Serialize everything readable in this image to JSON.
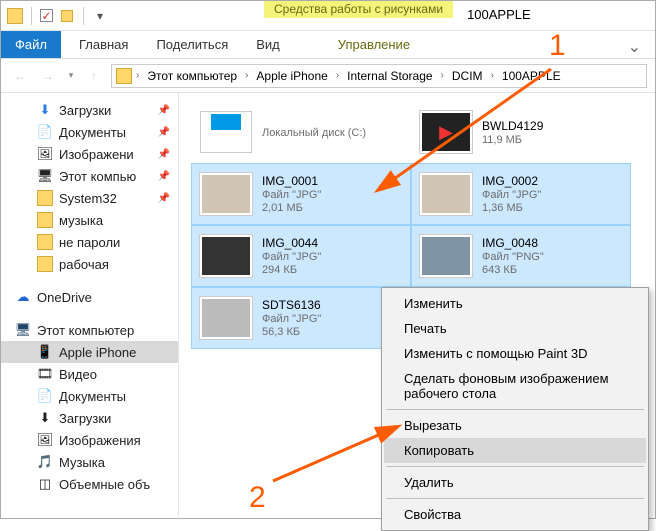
{
  "window": {
    "title": "100APPLE",
    "ctx_tab_header": "Средства работы с рисунками"
  },
  "ribbon": {
    "file": "Файл",
    "tabs": [
      "Главная",
      "Поделиться",
      "Вид"
    ],
    "ctx_tab": "Управление"
  },
  "breadcrumbs": [
    "Этот компьютер",
    "Apple iPhone",
    "Internal Storage",
    "DCIM",
    "100APPLE"
  ],
  "sidebar": {
    "quick": [
      {
        "label": "Загрузки",
        "icon": "download",
        "pinned": true
      },
      {
        "label": "Документы",
        "icon": "doc",
        "pinned": true
      },
      {
        "label": "Изображени",
        "icon": "picture",
        "pinned": true
      },
      {
        "label": "Этот компью",
        "icon": "pc",
        "pinned": true
      },
      {
        "label": "System32",
        "icon": "folder",
        "pinned": true
      },
      {
        "label": "музыка",
        "icon": "folder",
        "pinned": false
      },
      {
        "label": "не пароли",
        "icon": "folder",
        "pinned": false
      },
      {
        "label": "рабочая",
        "icon": "folder",
        "pinned": false
      }
    ],
    "onedrive": "OneDrive",
    "thispc_label": "Этот компьютер",
    "thispc": [
      {
        "label": "Apple iPhone",
        "icon": "phone",
        "selected": true
      },
      {
        "label": "Видео",
        "icon": "video"
      },
      {
        "label": "Документы",
        "icon": "doc"
      },
      {
        "label": "Загрузки",
        "icon": "download"
      },
      {
        "label": "Изображения",
        "icon": "picture"
      },
      {
        "label": "Музыка",
        "icon": "music"
      },
      {
        "label": "Объемные объ",
        "icon": "cube"
      }
    ]
  },
  "files": [
    {
      "name": "",
      "type": "Локальный диск (C:)",
      "size": "",
      "thumb": "drive",
      "selected": false
    },
    {
      "name": "BWLD4129",
      "type": "",
      "size": "11,9 МБ",
      "thumb": "video",
      "selected": false
    },
    {
      "name": "IMG_0001",
      "type": "Файл \"JPG\"",
      "size": "2,01 МБ",
      "thumb": "brown",
      "selected": true
    },
    {
      "name": "IMG_0002",
      "type": "Файл \"JPG\"",
      "size": "1,36 МБ",
      "thumb": "brown",
      "selected": true
    },
    {
      "name": "IMG_0044",
      "type": "Файл \"JPG\"",
      "size": "294 КБ",
      "thumb": "dark",
      "selected": true
    },
    {
      "name": "IMG_0048",
      "type": "Файл \"PNG\"",
      "size": "643 КБ",
      "thumb": "png",
      "selected": true
    },
    {
      "name": "SDTS6136",
      "type": "Файл \"JPG\"",
      "size": "56,3 КБ",
      "thumb": "gray",
      "selected": true
    }
  ],
  "context_menu": {
    "items": [
      "Изменить",
      "Печать",
      "Изменить с помощью Paint 3D",
      "Сделать фоновым изображением рабочего стола",
      "---",
      "Вырезать",
      "Копировать",
      "---",
      "Удалить",
      "---",
      "Свойства"
    ],
    "hover_index": 6
  },
  "annotations": {
    "one": "1",
    "two": "2"
  }
}
